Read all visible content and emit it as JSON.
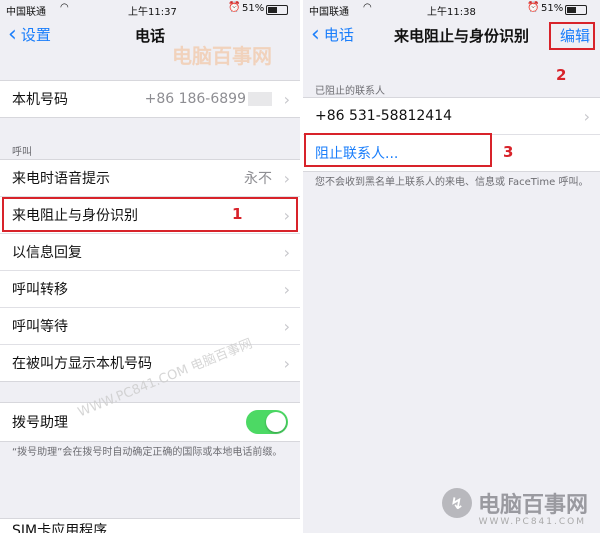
{
  "left": {
    "status": {
      "carrier": "中国联通",
      "time": "上午11:37",
      "battery": "51%"
    },
    "nav": {
      "back_label": "设置",
      "title": "电话"
    },
    "my_number": {
      "label": "本机号码",
      "value": "+86 186-6899"
    },
    "section_calls": "呼叫",
    "call_items": [
      {
        "label": "来电时语音提示",
        "value": "永不"
      },
      {
        "label": "来电阻止与身份识别",
        "value": ""
      },
      {
        "label": "以信息回复",
        "value": ""
      },
      {
        "label": "呼叫转移",
        "value": ""
      },
      {
        "label": "呼叫等待",
        "value": ""
      },
      {
        "label": "在被叫方显示本机号码",
        "value": ""
      }
    ],
    "dial_assist": {
      "label": "拨号助理",
      "on": true
    },
    "dial_assist_note": "“拨号助理”会在拨号时自动确定正确的国际或本地电话前缀。",
    "bottom_partial": "SIM卡应用程序"
  },
  "right": {
    "status": {
      "carrier": "中国联通",
      "time": "上午11:38",
      "battery": "51%"
    },
    "nav": {
      "back_label": "电话",
      "title": "来电阻止与身份识别",
      "edit_label": "编辑"
    },
    "section_blocked": "已阻止的联系人",
    "blocked_items": [
      {
        "label": "+86 531-58812414"
      }
    ],
    "block_contact_label": "阻止联系人...",
    "footnote": "您不会收到黑名单上联系人的来电、信息或 FaceTime 呼叫。"
  },
  "annotations": {
    "n1": "1",
    "n2": "2",
    "n3": "3"
  },
  "watermarks": {
    "logo_text": "电脑百事网",
    "logo_url": "WWW.PC841.COM",
    "diagonal": "WWW.PC841.COM 电脑百事网"
  },
  "colors": {
    "accent": "#1a7efb",
    "toggle_on": "#4cd964",
    "annotation_red": "#d8232a",
    "background": "#efeff4"
  },
  "icons": [
    "wifi-icon",
    "alarm-icon",
    "battery-icon",
    "chevron-left-icon",
    "chevron-right-icon"
  ]
}
